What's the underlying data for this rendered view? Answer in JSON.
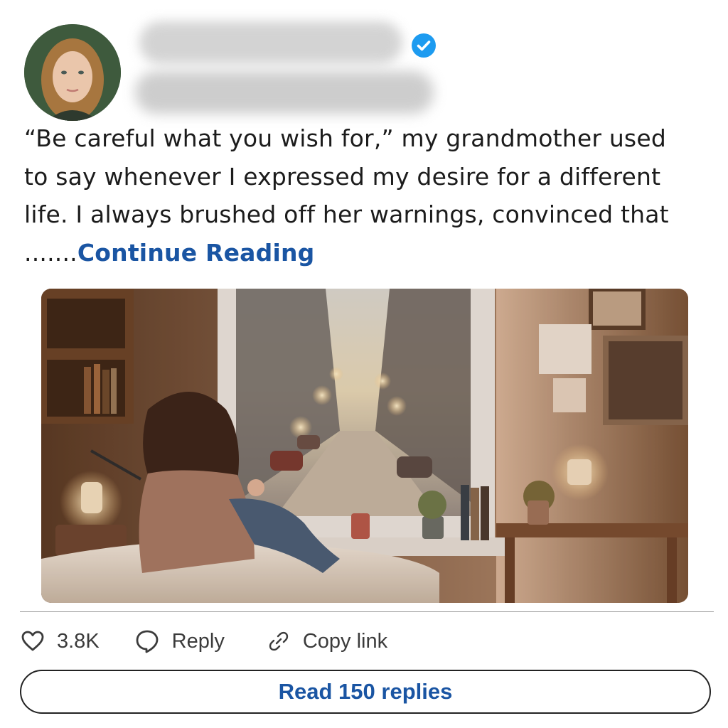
{
  "post": {
    "text": "“Be careful what you wish for,” my grandmother used to say whenever I expressed my desire for a different life. I always brushed off her warnings, convinced that .......",
    "continue_label": "Continue Reading"
  },
  "author": {
    "avatar_icon": "woman-portrait-avatar",
    "verified_icon": "verified-badge-icon",
    "verified_color": "#1d9bf0"
  },
  "media": {
    "icon": "woman-at-rainy-window-photo"
  },
  "actions": {
    "like_icon": "heart-icon",
    "like_count": "3.8K",
    "reply_icon": "speech-bubble-icon",
    "reply_label": "Reply",
    "copy_icon": "link-icon",
    "copy_label": "Copy link"
  },
  "footer": {
    "read_replies_label": "Read 150 replies"
  },
  "colors": {
    "accent": "#1a55a3",
    "text": "#1c1c1c",
    "divider": "#9a9a9a"
  }
}
